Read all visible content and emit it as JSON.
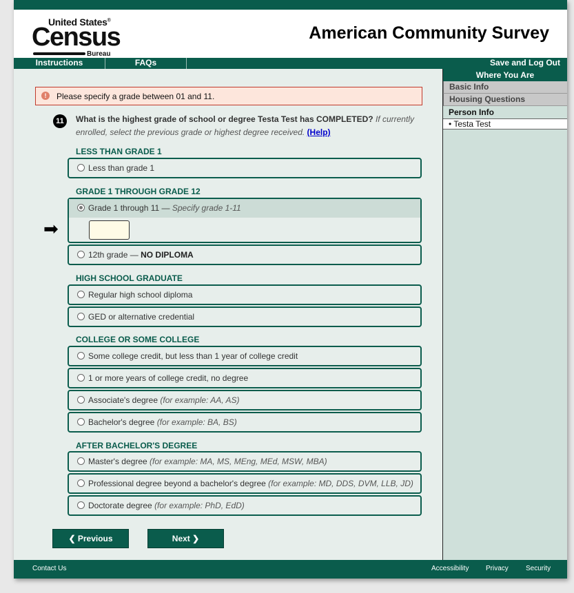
{
  "header": {
    "logo_line1": "United States",
    "logo_reg": "®",
    "logo_census": "Census",
    "logo_bureau": "Bureau",
    "site_title": "American Community Survey"
  },
  "nav": {
    "instructions": "Instructions",
    "faqs": "FAQs",
    "save_logout": "Save and Log Out"
  },
  "sidebar": {
    "title": "Where You Are",
    "items": [
      "Basic Info",
      "Housing Questions",
      "Person Info"
    ],
    "current_person": "• Testa Test"
  },
  "error": {
    "icon": "!",
    "message": "Please specify a grade between 01 and 11."
  },
  "question": {
    "number": "11",
    "text": "What is the highest grade of school or degree Testa Test has COMPLETED?",
    "note": "If currently enrolled, select the previous grade or highest degree received.",
    "help": "(Help)"
  },
  "sections": {
    "less_than_1": "LESS THAN GRADE 1",
    "grade_1_12": "GRADE 1 THROUGH GRADE 12",
    "hs_grad": "HIGH SCHOOL GRADUATE",
    "college": "COLLEGE OR SOME COLLEGE",
    "after_ba": "AFTER BACHELOR'S DEGREE"
  },
  "options": {
    "less_than_1": "Less than grade 1",
    "gr111_main": "Grade 1 through 11 — ",
    "gr111_note": "Specify grade 1-11",
    "gr12_main": "12th grade — ",
    "gr12_bold": "NO DIPLOMA",
    "hs_diploma": "Regular high school diploma",
    "ged": "GED or alternative credential",
    "some_college": "Some college credit, but less than 1 year of college credit",
    "college_1plus": "1 or more years of college credit, no degree",
    "associate_main": "Associate's degree ",
    "associate_note": "(for example: AA, AS)",
    "bachelor_main": "Bachelor's degree ",
    "bachelor_note": "(for example: BA, BS)",
    "master_main": "Master's degree ",
    "master_note": "(for example: MA, MS, MEng, MEd, MSW, MBA)",
    "professional_main": "Professional degree beyond a bachelor's degree ",
    "professional_note": "(for example: MD, DDS, DVM, LLB, JD)",
    "doctorate_main": "Doctorate degree ",
    "doctorate_note": "(for example: PhD, EdD)"
  },
  "grade_input": {
    "value": ""
  },
  "arrow": "➡",
  "buttons": {
    "previous": "❮ Previous",
    "next": "Next ❯"
  },
  "footer": {
    "contact": "Contact Us",
    "accessibility": "Accessibility",
    "privacy": "Privacy",
    "security": "Security"
  }
}
